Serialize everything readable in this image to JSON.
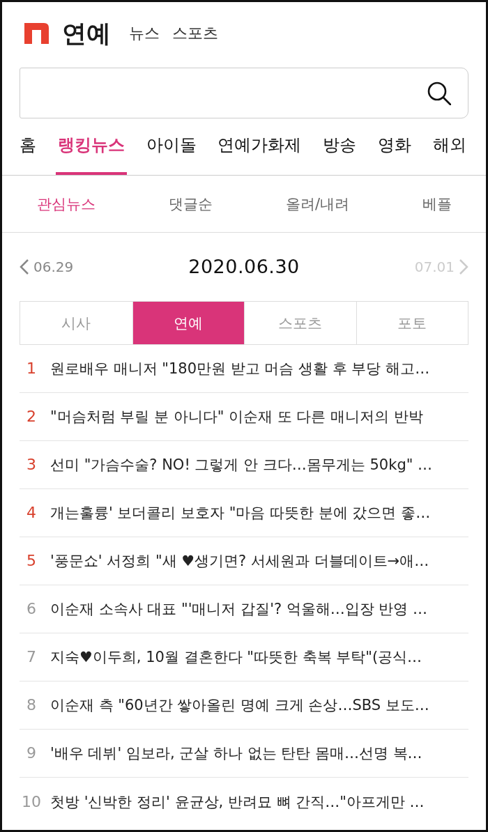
{
  "header": {
    "title": "연예",
    "links": [
      "뉴스",
      "스포츠"
    ]
  },
  "nav_tabs": [
    {
      "label": "홈",
      "selected": false
    },
    {
      "label": "랭킹뉴스",
      "selected": true
    },
    {
      "label": "아이돌",
      "selected": false
    },
    {
      "label": "연예가화제",
      "selected": false
    },
    {
      "label": "방송",
      "selected": false
    },
    {
      "label": "영화",
      "selected": false
    },
    {
      "label": "해외",
      "selected": false
    }
  ],
  "sub_tabs": [
    {
      "label": "관심뉴스",
      "selected": true
    },
    {
      "label": "댓글순",
      "selected": false
    },
    {
      "label": "올려/내려",
      "selected": false
    },
    {
      "label": "베플",
      "selected": false
    }
  ],
  "date_nav": {
    "previous": {
      "label": "06.29",
      "disabled": false
    },
    "current": "2020.06.30",
    "next": {
      "label": "07.01",
      "disabled": true
    }
  },
  "category_tabs": [
    {
      "label": "시사",
      "selected": false
    },
    {
      "label": "연예",
      "selected": true
    },
    {
      "label": "스포츠",
      "selected": false
    },
    {
      "label": "포토",
      "selected": false
    }
  ],
  "ranking": [
    {
      "rank": "1",
      "title": "원로배우 매니저 \"180만원 받고 머슴 생활 후 부당 해고…",
      "highlighted": true
    },
    {
      "rank": "2",
      "title": "\"머슴처럼 부릴 분 아니다\" 이순재 또 다른 매니저의 반박",
      "highlighted": true
    },
    {
      "rank": "3",
      "title": "선미 \"가슴수술? NO! 그렇게 안 크다…몸무게는 50kg\" …",
      "highlighted": true
    },
    {
      "rank": "4",
      "title": "개는훌륭' 보더콜리 보호자 \"마음 따뜻한 분에 갔으면 좋…",
      "highlighted": true
    },
    {
      "rank": "5",
      "title": "'풍문쇼' 서정희 \"새 ♥생기면? 서세원과 더블데이트→애…",
      "highlighted": true
    },
    {
      "rank": "6",
      "title": "이순재 소속사 대표 \"'매니저 갑질'? 억울해…입장 반영 …",
      "highlighted": false
    },
    {
      "rank": "7",
      "title": "지숙♥이두희, 10월 결혼한다 \"따뜻한 축복 부탁\"(공식…",
      "highlighted": false
    },
    {
      "rank": "8",
      "title": "이순재 측 \"60년간 쌓아올린 명예 크게 손상…SBS 보도…",
      "highlighted": false
    },
    {
      "rank": "9",
      "title": "'배우 데뷔' 임보라, 군살 하나 없는 탄탄 몸매…선명 복…",
      "highlighted": false
    },
    {
      "rank": "10",
      "title": "첫방 '신박한 정리' 윤균상, 반려묘 뼈 간직…\"아프게만 …",
      "highlighted": false
    }
  ]
}
